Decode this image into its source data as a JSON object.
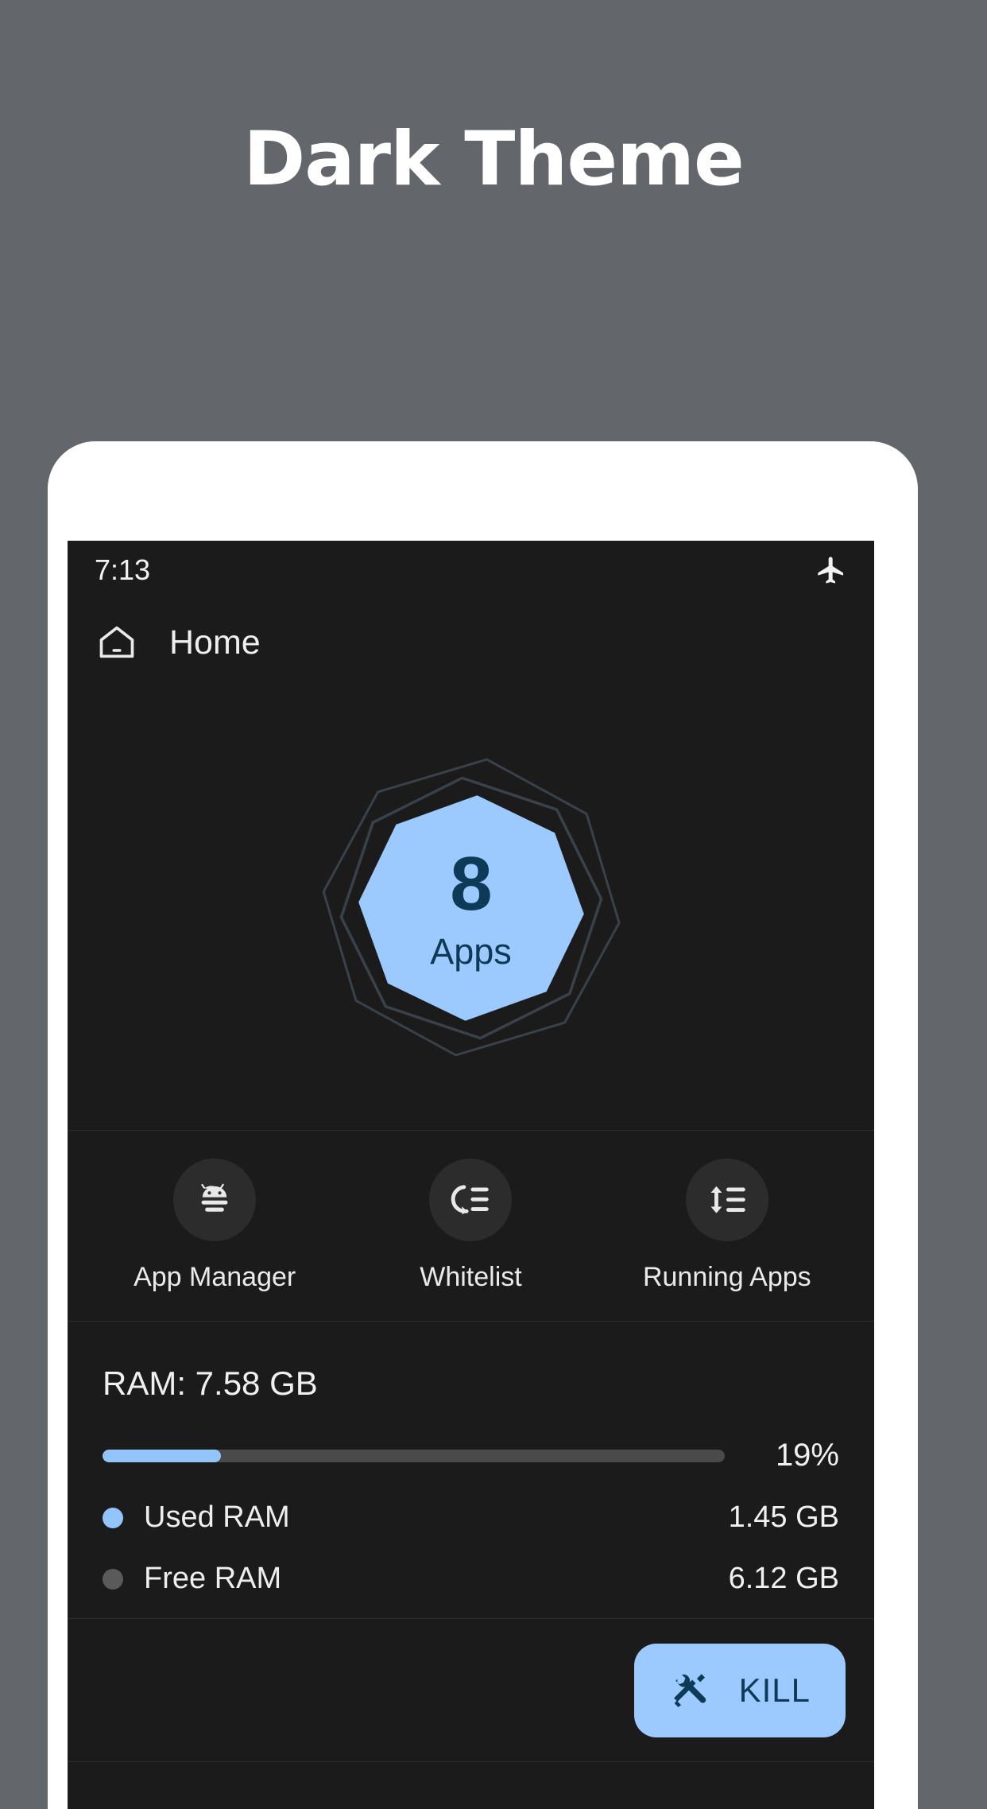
{
  "promo": {
    "title": "Dark Theme"
  },
  "theme": {
    "page_background": "#63666A",
    "screen_background": "#1b1b1b",
    "accent_blue": "#9ccaff",
    "accent_dark_navy": "#0d3a57",
    "surface": "#2c2c2c",
    "divider": "#2e2e2e"
  },
  "status_bar": {
    "time": "7:13",
    "airplane_icon": "airplane-icon"
  },
  "app_bar": {
    "home_icon": "home-icon",
    "title": "Home"
  },
  "gauge": {
    "count": "8",
    "label": "Apps",
    "fill_color": "#9ccaff",
    "ring_color": "#33393f"
  },
  "quick_actions": [
    {
      "icon": "android-robot-icon",
      "label": "App Manager"
    },
    {
      "icon": "whitelist-icon",
      "label": "Whitelist"
    },
    {
      "icon": "running-apps-icon",
      "label": "Running Apps"
    }
  ],
  "ram": {
    "total_label": "RAM: 7.58 GB",
    "percent_label": "19%",
    "percent_value": 19,
    "rows": [
      {
        "dot_color": "#93c5fd",
        "name": "Used RAM",
        "value": "1.45 GB"
      },
      {
        "dot_color": "#5a5a5a",
        "name": "Free RAM",
        "value": "6.12 GB"
      }
    ]
  },
  "kill": {
    "icon": "tools-icon",
    "label": "KILL"
  }
}
